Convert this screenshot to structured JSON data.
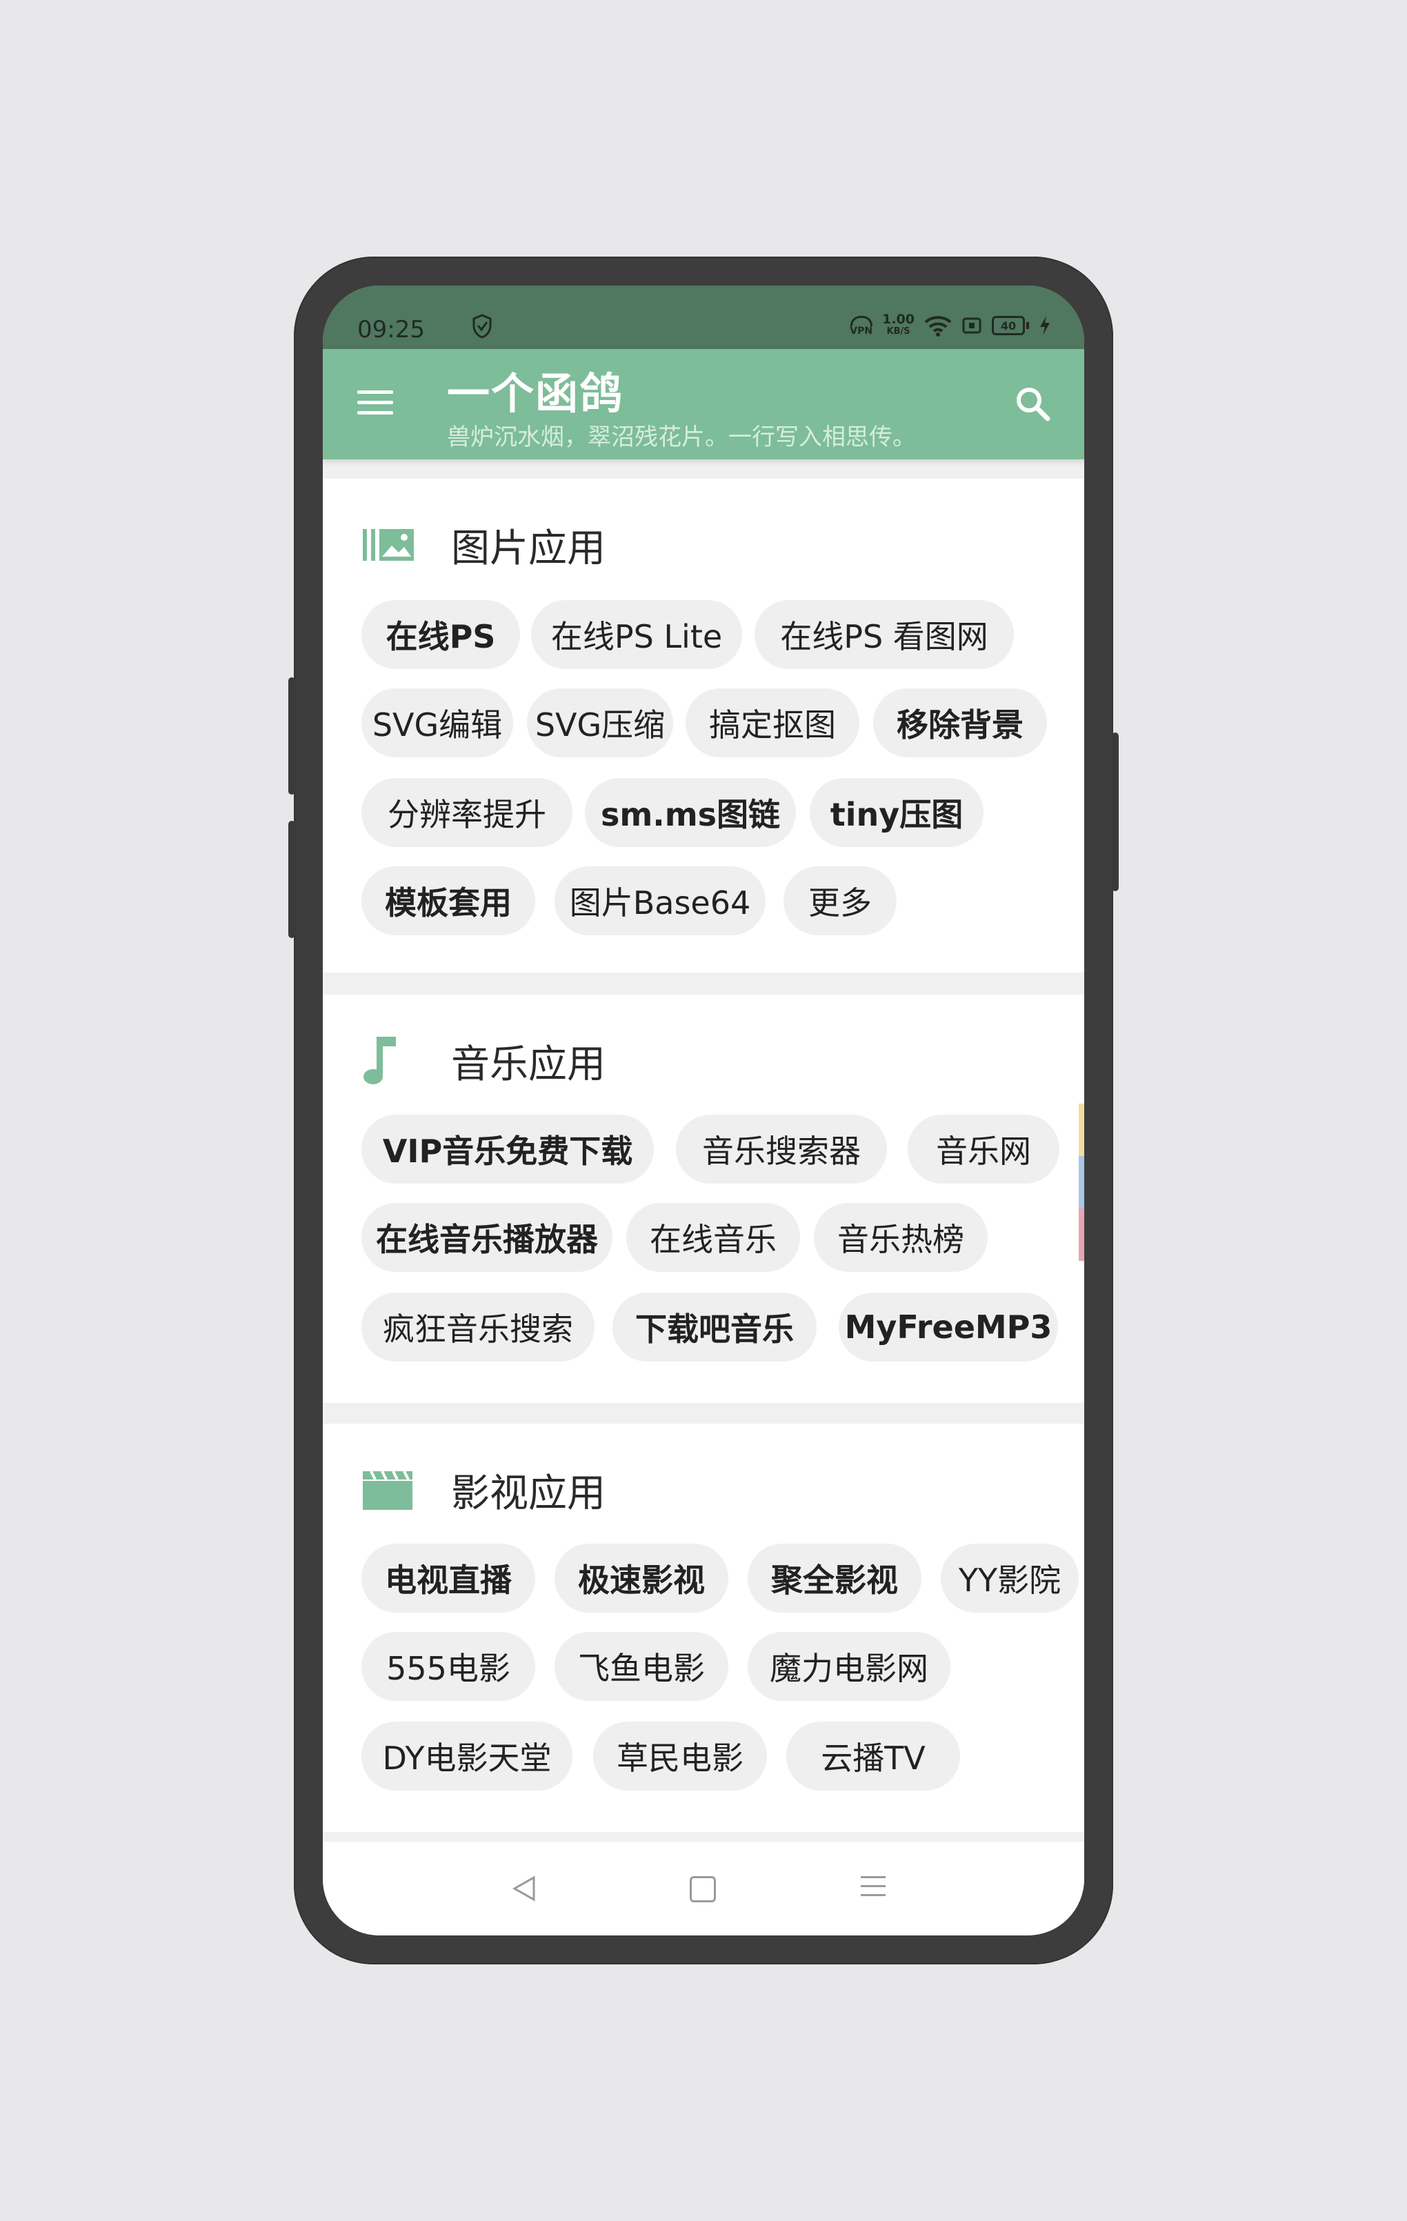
{
  "statusbar": {
    "time": "09:25",
    "speed_value": "1.00",
    "speed_unit": "KB/S",
    "vpn_label": "VPN",
    "battery": "40"
  },
  "appbar": {
    "title": "一个函鸽",
    "subtitle": "兽炉沉水烟，翠沼残花片。一行写入相思传。"
  },
  "sections": [
    {
      "title": "图片应用",
      "icon": "image-gallery-icon",
      "chips": [
        "在线PS",
        "在线PS Lite",
        "在线PS 看图网",
        "SVG编辑",
        "SVG压缩",
        "搞定抠图",
        "移除背景",
        "分辨率提升",
        "sm.ms图链",
        "tiny压图",
        "模板套用",
        "图片Base64",
        "更多"
      ]
    },
    {
      "title": "音乐应用",
      "icon": "music-note-icon",
      "chips": [
        "VIP音乐免费下载",
        "音乐搜索器",
        "音乐网",
        "在线音乐播放器",
        "在线音乐",
        "音乐热榜",
        "疯狂音乐搜索",
        "下载吧音乐",
        "MyFreeMP3"
      ]
    },
    {
      "title": "影视应用",
      "icon": "clapperboard-icon",
      "chips": [
        "电视直播",
        "极速影视",
        "聚全影视",
        "YY影院",
        "555电影",
        "飞鱼电影",
        "魔力电影网",
        "DY电影天堂",
        "草民电影",
        "云播TV"
      ]
    }
  ],
  "colors": {
    "statusbar": "#50775f",
    "accent": "#7dbd99",
    "chip_bg": "#efefef",
    "edge_yellow": "#f3dca0",
    "edge_blue": "#a9c7e8",
    "edge_pink": "#e8a4b4"
  }
}
